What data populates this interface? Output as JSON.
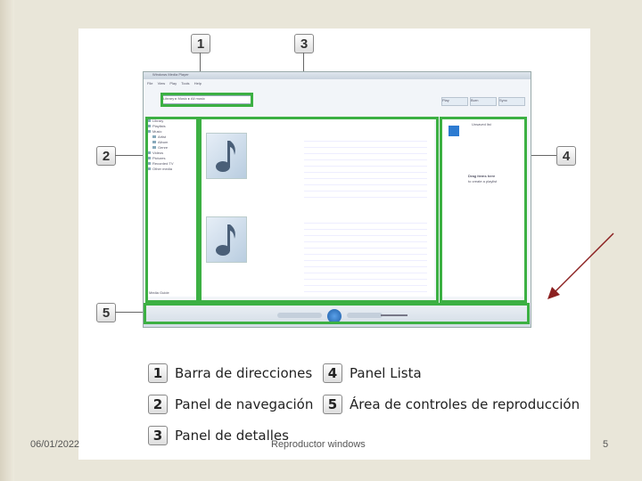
{
  "footer": {
    "date": "06/01/2022",
    "title": "Reproductor windows",
    "page_number": "5"
  },
  "callouts": {
    "c1": "1",
    "c2": "2",
    "c3": "3",
    "c4": "4",
    "c5": "5"
  },
  "wmp": {
    "window_title": "Windows Media Player",
    "menu": [
      "File",
      "View",
      "Play",
      "Tools",
      "Help"
    ],
    "address": "Library ▸ Music ▸ All music",
    "tabs": [
      "Play",
      "Burn",
      "Sync"
    ],
    "nav_items": [
      "Library",
      "Playlists",
      "Music",
      "Artist",
      "Album",
      "Genre",
      "Videos",
      "Pictures",
      "Recorded TV",
      "Other media"
    ],
    "media_guide": "Media Guide",
    "list_panel": {
      "title": "Unsaved list",
      "drag_hint": "Drag items here",
      "sub_hint": "to create a playlist"
    }
  },
  "legend": [
    {
      "num": "1",
      "label": "Barra de direcciones"
    },
    {
      "num": "2",
      "label": "Panel de navegación"
    },
    {
      "num": "3",
      "label": "Panel de detalles"
    },
    {
      "num": "4",
      "label": "Panel Lista"
    },
    {
      "num": "5",
      "label": "Área de controles de reproducción"
    }
  ],
  "colors": {
    "highlight": "#3cb043",
    "arrow": "#8b2020",
    "background": "#e9e6d9"
  }
}
